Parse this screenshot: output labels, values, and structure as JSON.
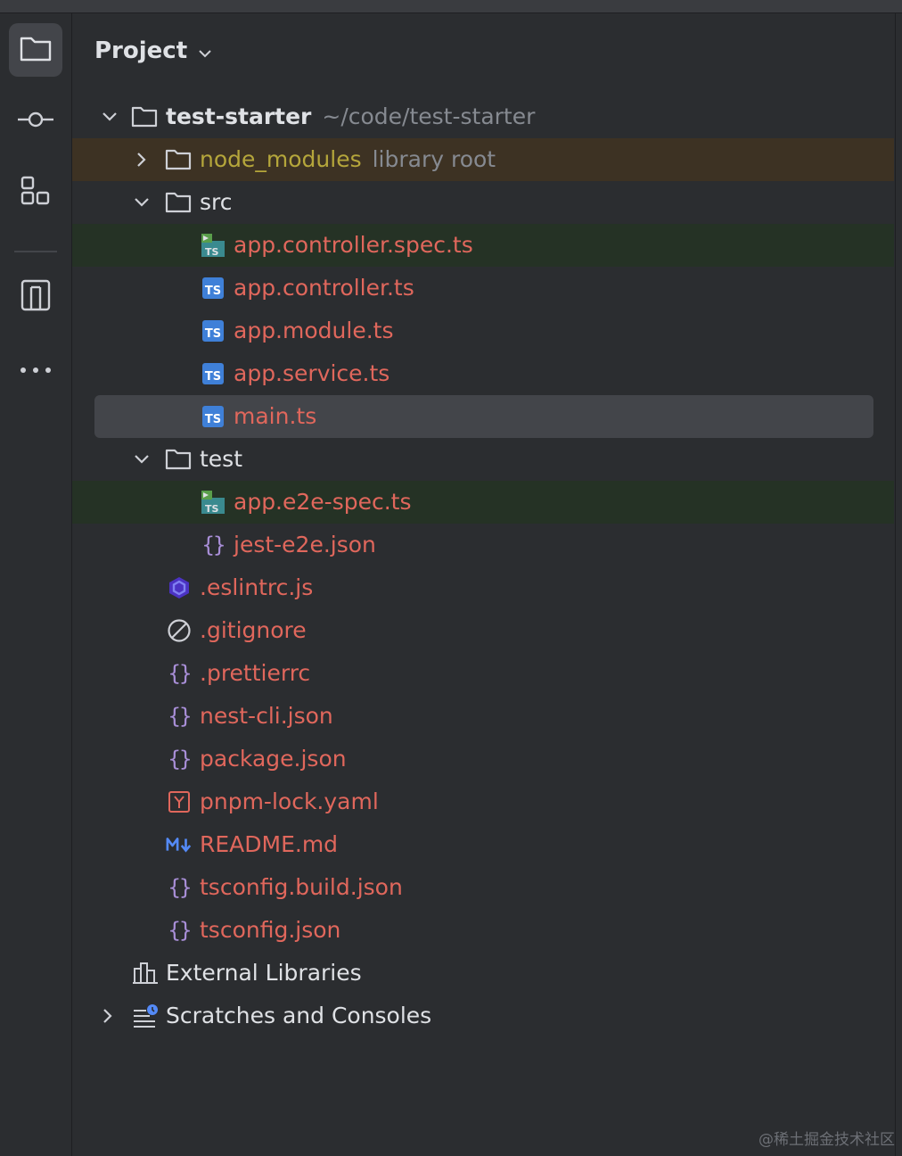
{
  "panel": {
    "title": "Project"
  },
  "stripe": {
    "items": [
      {
        "icon": "folder-icon",
        "active": true
      },
      {
        "icon": "commit-icon",
        "active": false
      },
      {
        "icon": "structure-icon",
        "active": false
      },
      {
        "icon": "pull-requests-icon",
        "active": false
      },
      {
        "icon": "more-icon",
        "active": false
      }
    ]
  },
  "tree": {
    "root": {
      "name": "test-starter",
      "path": "~/code/test-starter"
    },
    "node_modules": {
      "name": "node_modules",
      "hint": "library root"
    },
    "src": {
      "name": "src",
      "files": [
        "app.controller.spec.ts",
        "app.controller.ts",
        "app.module.ts",
        "app.service.ts",
        "main.ts"
      ]
    },
    "test": {
      "name": "test",
      "files": [
        "app.e2e-spec.ts",
        "jest-e2e.json"
      ]
    },
    "root_files": [
      ".eslintrc.js",
      ".gitignore",
      ".prettierrc",
      "nest-cli.json",
      "package.json",
      "pnpm-lock.yaml",
      "README.md",
      "tsconfig.build.json",
      "tsconfig.json"
    ],
    "external_libraries": "External Libraries",
    "scratches": "Scratches and Consoles"
  },
  "colors": {
    "background": "#2b2d30",
    "selection": "#43454a",
    "library_root_bg": "#3d3223",
    "test_bg": "#253225",
    "modified_file": "#e0675c",
    "library_root_text": "#b5a63b"
  },
  "watermark": "@稀土掘金技术社区"
}
